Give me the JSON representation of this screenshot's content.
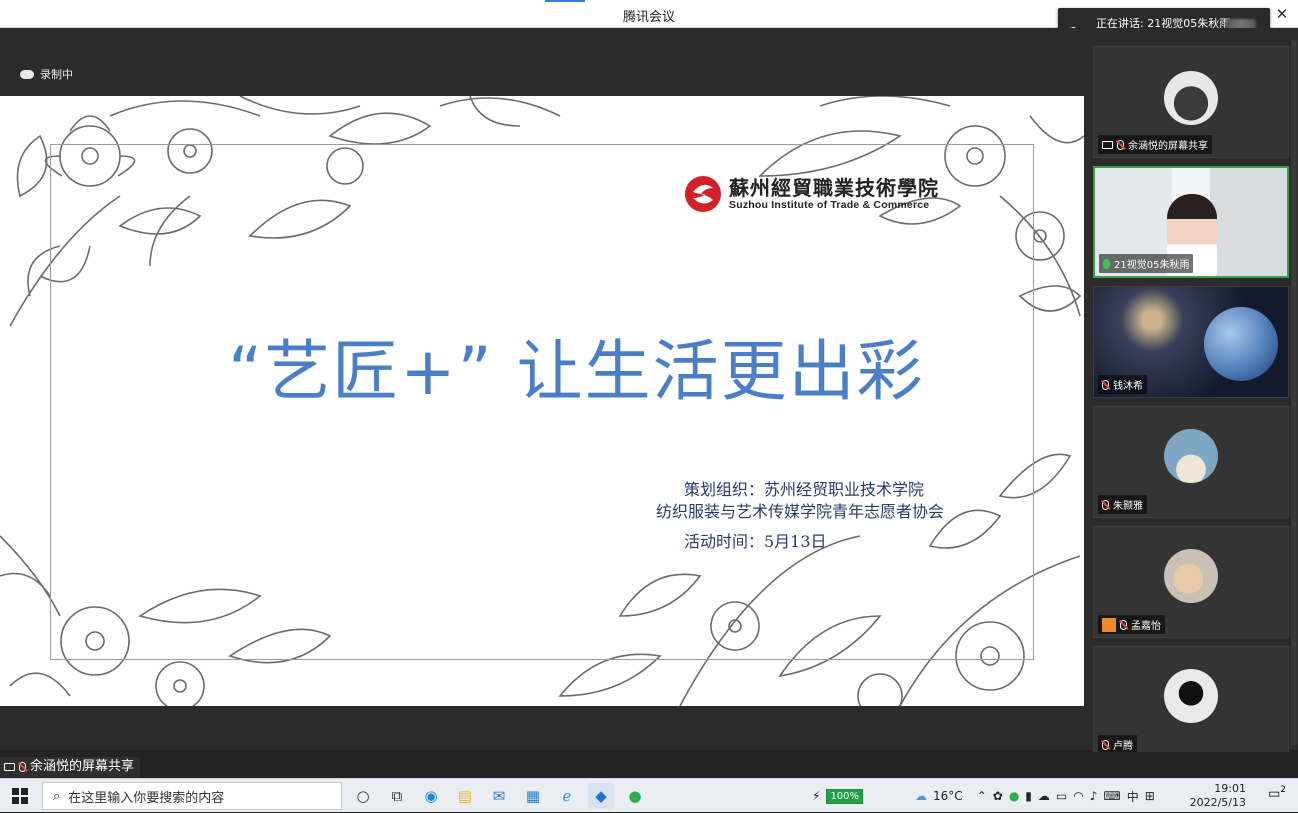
{
  "window": {
    "title": "腾讯会议",
    "close_glyph": "✕"
  },
  "speaking": {
    "label": "正在讲话: 21视觉05朱秋雨;"
  },
  "recording": {
    "label": "录制中"
  },
  "slide": {
    "logo_cn": "蘇州經貿職業技術學院",
    "logo_en": "Suzhou Institute of Trade & Commerce",
    "headline": "“艺匠+”  让生活更出彩",
    "organizer_line1": "策划组织：苏州经贸职业技术学院",
    "organizer_line2": "纺织服装与艺术传媒学院青年志愿者协会",
    "date_line": "活动时间：5月13日",
    "headline_color": "#4a7fc8",
    "logo_color": "#d32027"
  },
  "participants": [
    {
      "name": "余涵悦的屏幕共享",
      "status": "sharing"
    },
    {
      "name": "21视觉05朱秋雨",
      "status": "speaking"
    },
    {
      "name": "钱沐希",
      "status": "muted"
    },
    {
      "name": "朱颢雅",
      "status": "muted"
    },
    {
      "name": "孟嘉怡",
      "status": "muted"
    },
    {
      "name": "卢腾",
      "status": "muted"
    }
  ],
  "sharebar": {
    "label": "余涵悦的屏幕共享"
  },
  "taskbar": {
    "search_placeholder": "在这里输入你要搜索的内容",
    "battery": "100%",
    "weather": "16°C",
    "ime": "中",
    "time": "19:01",
    "date": "2022/5/13",
    "notifications": "2"
  }
}
